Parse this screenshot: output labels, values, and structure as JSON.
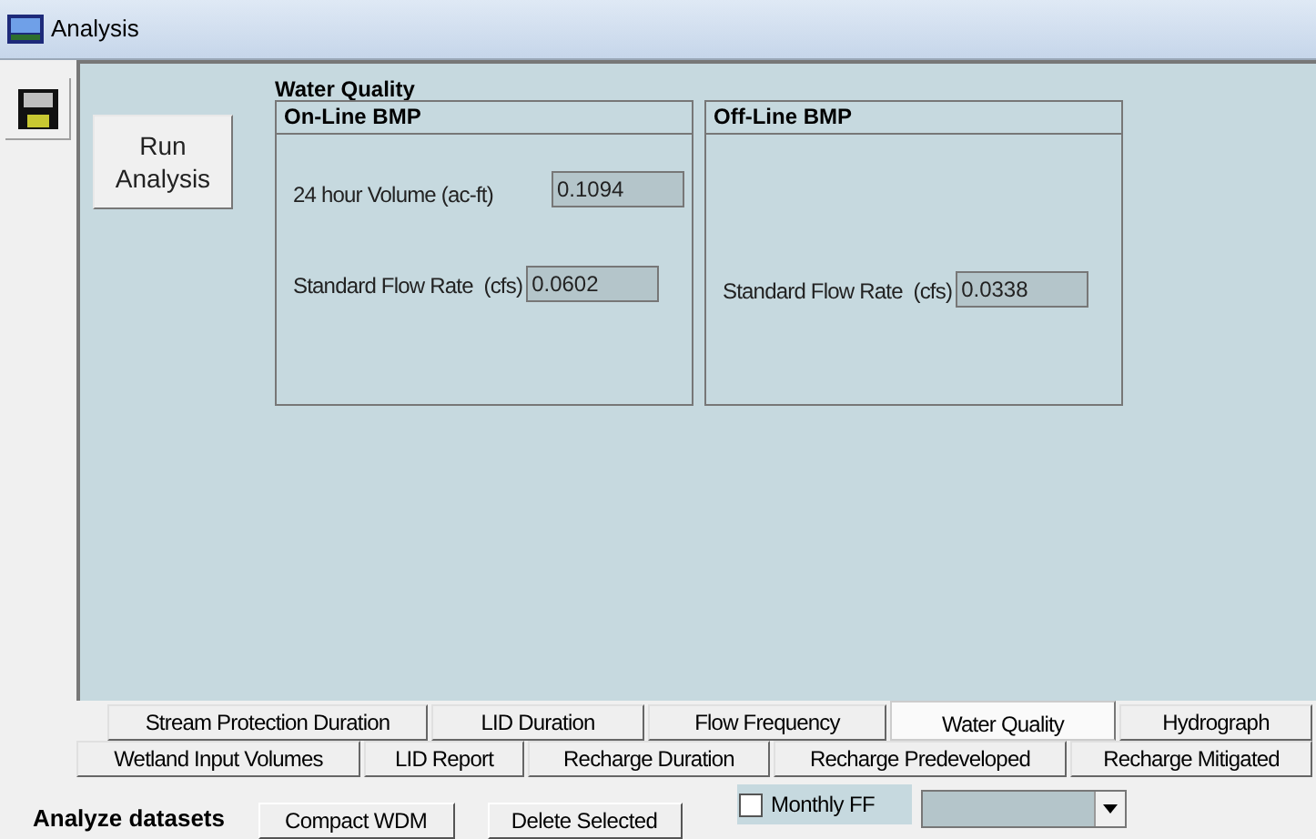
{
  "window": {
    "title": "Analysis"
  },
  "run_button": {
    "label": "Run Analysis"
  },
  "section_title": "Water Quality",
  "groups": [
    {
      "title": "On-Line BMP",
      "fields": [
        {
          "label": "24 hour Volume (ac-ft)",
          "value": "0.1094"
        },
        {
          "label": "Standard Flow Rate  (cfs)",
          "value": "0.0602"
        }
      ]
    },
    {
      "title": "Off-Line BMP",
      "fields": [
        {
          "label": "Standard Flow Rate  (cfs)",
          "value": "0.0338"
        }
      ]
    }
  ],
  "tab_rows": [
    [
      {
        "label": "Stream Protection Duration",
        "selected": false
      },
      {
        "label": "LID Duration",
        "selected": false
      },
      {
        "label": "Flow Frequency",
        "selected": false
      },
      {
        "label": "Water Quality",
        "selected": true
      },
      {
        "label": "Hydrograph",
        "selected": false
      }
    ],
    [
      {
        "label": "Wetland Input Volumes",
        "selected": false
      },
      {
        "label": "LID Report",
        "selected": false
      },
      {
        "label": "Recharge Duration",
        "selected": false
      },
      {
        "label": "Recharge Predeveloped",
        "selected": false
      },
      {
        "label": "Recharge Mitigated",
        "selected": false
      }
    ]
  ],
  "bottom_bar": {
    "label": "Analyze datasets",
    "buttons": [
      "Compact WDM",
      "Delete Selected"
    ],
    "checkbox": {
      "label": "Monthly FF",
      "checked": false
    }
  }
}
